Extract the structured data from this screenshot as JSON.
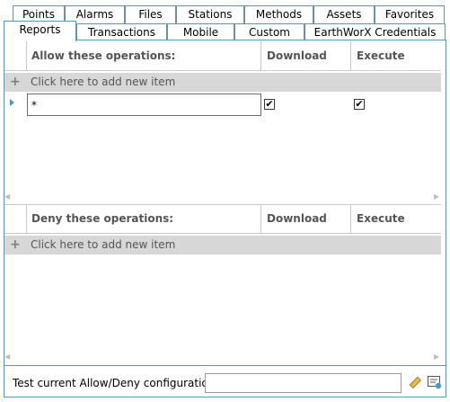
{
  "tabs_row1": [
    "Points",
    "Alarms",
    "Files",
    "Stations",
    "Methods",
    "Assets",
    "Favorites"
  ],
  "tabs_row2": [
    "Reports",
    "Transactions",
    "Mobile",
    "Custom",
    "EarthWorX Credentials"
  ],
  "active_tab": "Reports",
  "allow": {
    "col_operations": "Allow these operations:",
    "col_download": "Download",
    "col_execute": "Execute",
    "add_row": "Click here to add new item",
    "rows": [
      {
        "operation": "*",
        "download": true,
        "execute": true
      }
    ]
  },
  "deny": {
    "col_operations": "Deny these operations:",
    "col_download": "Download",
    "col_execute": "Execute",
    "add_row": "Click here to add new item"
  },
  "footer": {
    "test_label": "Test current Allow/Deny configuration:",
    "test_value": ""
  },
  "icons": {
    "row_indicator": "triangle-right-icon",
    "test": "ruler-pencil-icon",
    "info": "report-icon"
  }
}
